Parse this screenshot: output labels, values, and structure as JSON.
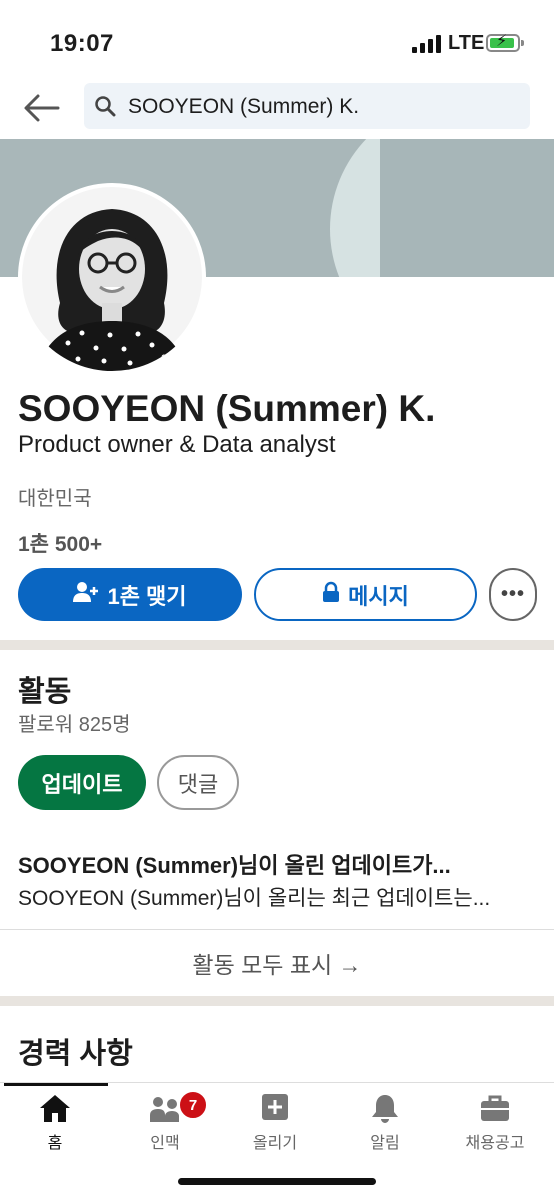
{
  "status": {
    "time": "19:07",
    "network": "LTE"
  },
  "search": {
    "query": "SOOYEON (Summer) K."
  },
  "profile": {
    "name": "SOOYEON (Summer) K.",
    "headline": "Product owner & Data analyst",
    "location": "대한민국",
    "connections": "1촌 500+"
  },
  "actions": {
    "connect": "1촌 맺기",
    "message": "메시지",
    "more": "•••"
  },
  "activity": {
    "title": "활동",
    "followers": "팔로워 825명",
    "tabs": [
      {
        "label": "업데이트",
        "active": true
      },
      {
        "label": "댓글",
        "active": false
      }
    ],
    "post_title": "SOOYEON (Summer)님이 올린 업데이트가...",
    "post_subtitle": "SOOYEON (Summer)님이 올리는 최근 업데이트는...",
    "show_all": "활동 모두 표시 →"
  },
  "experience": {
    "title": "경력 사항"
  },
  "tabbar": {
    "items": [
      {
        "label": "홈",
        "icon": "home-icon",
        "active": true
      },
      {
        "label": "인맥",
        "icon": "network-icon",
        "badge": "7"
      },
      {
        "label": "올리기",
        "icon": "post-icon"
      },
      {
        "label": "알림",
        "icon": "bell-icon"
      },
      {
        "label": "채용공고",
        "icon": "briefcase-icon"
      }
    ]
  },
  "colors": {
    "accent": "#0a66c2",
    "active_pill": "#057642",
    "badge": "#cc1016",
    "divider": "#e8e4df"
  }
}
